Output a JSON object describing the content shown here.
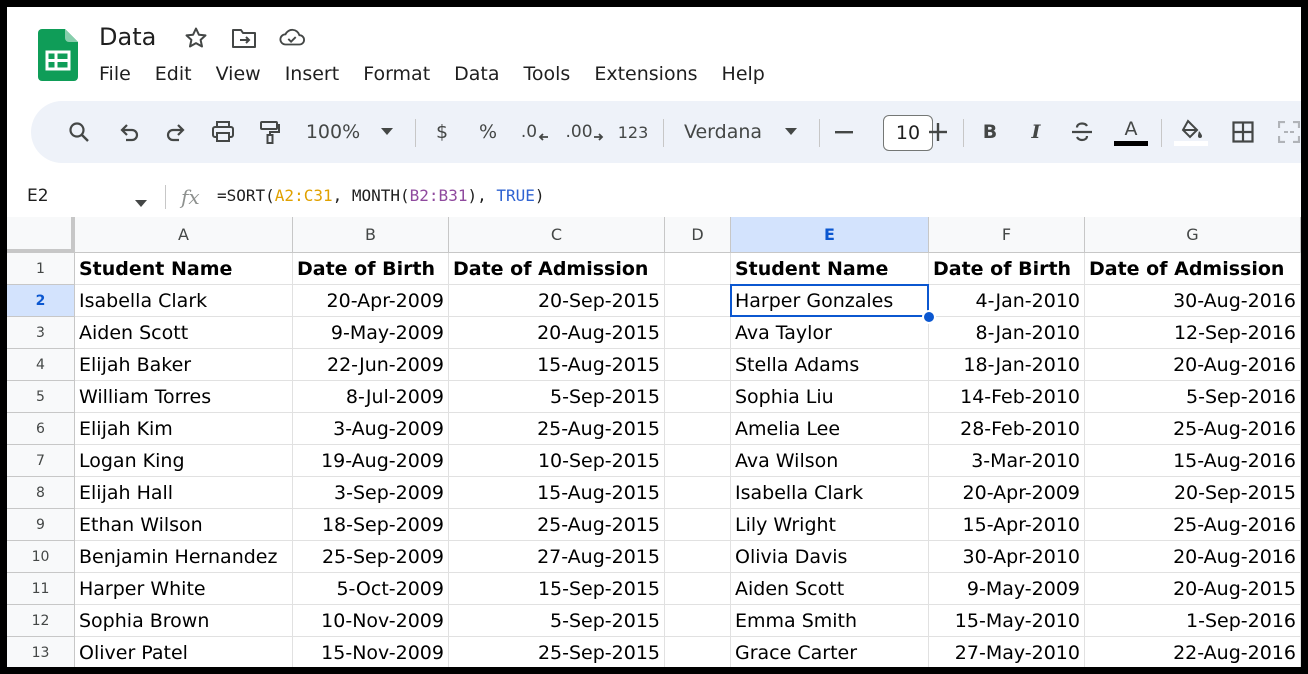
{
  "app": {
    "title": "Data",
    "menu": [
      "File",
      "Edit",
      "View",
      "Insert",
      "Format",
      "Data",
      "Tools",
      "Extensions",
      "Help"
    ]
  },
  "toolbar": {
    "zoom": "100%",
    "currency": "$",
    "percent": "%",
    "decrease_decimal": ".0",
    "increase_decimal": ".00",
    "number_format": "123",
    "font": "Verdana",
    "font_size": "10",
    "bold": "B",
    "italic": "I",
    "text_color_letter": "A",
    "accent_color": "#0b57d0"
  },
  "formula_bar": {
    "name_box": "E2",
    "fx": "fx",
    "formula_parts": [
      {
        "text": "=SORT(",
        "color": "#1f1f1f"
      },
      {
        "text": "A2:C31",
        "color": "#e0a100"
      },
      {
        "text": ", MONTH(",
        "color": "#1f1f1f"
      },
      {
        "text": "B2:B31",
        "color": "#8f4a9e"
      },
      {
        "text": "), ",
        "color": "#1f1f1f"
      },
      {
        "text": "TRUE",
        "color": "#2f63d2"
      },
      {
        "text": ")",
        "color": "#1f1f1f"
      }
    ]
  },
  "grid": {
    "columns": [
      "A",
      "B",
      "C",
      "D",
      "E",
      "F",
      "G"
    ],
    "selected_column": "E",
    "selected_row": "2",
    "row_numbers": [
      "1",
      "2",
      "3",
      "4",
      "5",
      "6",
      "7",
      "8",
      "9",
      "10",
      "11",
      "12",
      "13"
    ],
    "rows": [
      [
        "Student Name",
        "Date of Birth",
        "Date of Admission",
        "",
        "Student Name",
        "Date of Birth",
        "Date of Admission"
      ],
      [
        "Isabella Clark",
        "20-Apr-2009",
        "20-Sep-2015",
        "",
        "Harper Gonzales",
        "4-Jan-2010",
        "30-Aug-2016"
      ],
      [
        "Aiden Scott",
        "9-May-2009",
        "20-Aug-2015",
        "",
        "Ava Taylor",
        "8-Jan-2010",
        "12-Sep-2016"
      ],
      [
        "Elijah Baker",
        "22-Jun-2009",
        "15-Aug-2015",
        "",
        "Stella Adams",
        "18-Jan-2010",
        "20-Aug-2016"
      ],
      [
        "William Torres",
        "8-Jul-2009",
        "5-Sep-2015",
        "",
        "Sophia Liu",
        "14-Feb-2010",
        "5-Sep-2016"
      ],
      [
        "Elijah Kim",
        "3-Aug-2009",
        "25-Aug-2015",
        "",
        "Amelia Lee",
        "28-Feb-2010",
        "25-Aug-2016"
      ],
      [
        "Logan King",
        "19-Aug-2009",
        "10-Sep-2015",
        "",
        "Ava Wilson",
        "3-Mar-2010",
        "15-Aug-2016"
      ],
      [
        "Elijah Hall",
        "3-Sep-2009",
        "15-Aug-2015",
        "",
        "Isabella Clark",
        "20-Apr-2009",
        "20-Sep-2015"
      ],
      [
        "Ethan Wilson",
        "18-Sep-2009",
        "25-Aug-2015",
        "",
        "Lily Wright",
        "15-Apr-2010",
        "25-Aug-2016"
      ],
      [
        "Benjamin Hernandez",
        "25-Sep-2009",
        "27-Aug-2015",
        "",
        "Olivia Davis",
        "30-Apr-2010",
        "20-Aug-2016"
      ],
      [
        "Harper White",
        "5-Oct-2009",
        "15-Sep-2015",
        "",
        "Aiden Scott",
        "9-May-2009",
        "20-Aug-2015"
      ],
      [
        "Sophia Brown",
        "10-Nov-2009",
        "5-Sep-2015",
        "",
        "Emma Smith",
        "15-May-2010",
        "1-Sep-2016"
      ],
      [
        "Oliver Patel",
        "15-Nov-2009",
        "25-Sep-2015",
        "",
        "Grace Carter",
        "27-May-2010",
        "22-Aug-2016"
      ]
    ]
  }
}
